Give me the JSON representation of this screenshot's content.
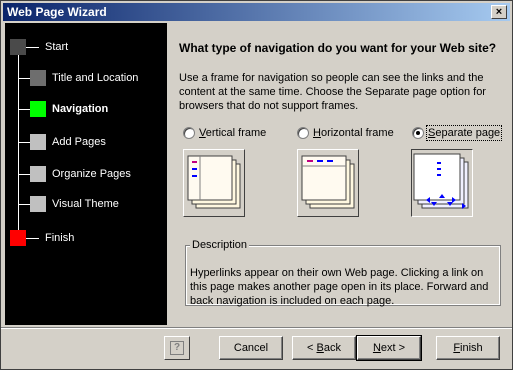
{
  "window": {
    "title": "Web Page Wizard",
    "close_label": "×"
  },
  "steps": [
    {
      "label": "Start",
      "state": "boundary",
      "color": "#4a4a4a"
    },
    {
      "label": "Title and Location",
      "state": "done",
      "color": "#6e6e6e"
    },
    {
      "label": "Navigation",
      "state": "current",
      "color": "#00ff00"
    },
    {
      "label": "Add Pages",
      "state": "pending",
      "color": "#c0c0c0"
    },
    {
      "label": "Organize Pages",
      "state": "pending",
      "color": "#c0c0c0"
    },
    {
      "label": "Visual Theme",
      "state": "pending",
      "color": "#c0c0c0"
    },
    {
      "label": "Finish",
      "state": "boundary",
      "color": "#ff0000"
    }
  ],
  "content": {
    "heading": "What type of navigation do you want for your Web site?",
    "intro": "Use a frame for navigation so people can see the links and the content at the same time.  Choose the Separate page option for browsers that do not support frames.",
    "options": [
      {
        "accel": "V",
        "rest": "ertical frame",
        "selected": false,
        "icon": "vertical-frame-icon"
      },
      {
        "accel": "H",
        "rest": "orizontal frame",
        "selected": false,
        "icon": "horizontal-frame-icon"
      },
      {
        "accel": "S",
        "rest": "eparate page",
        "selected": true,
        "icon": "separate-page-icon"
      }
    ],
    "description_title": "Description",
    "description": "Hyperlinks appear on their own Web page.  Clicking a link on this page makes another page open in its place.  Forward and back navigation is included on each page."
  },
  "buttons": {
    "help_glyph": "?",
    "cancel": "Cancel",
    "back_prefix": "< ",
    "back_accel": "B",
    "back_rest": "ack",
    "next_accel": "N",
    "next_rest": "ext >",
    "finish_accel": "F",
    "finish_rest": "inish"
  },
  "colors": {
    "titlebar_start": "#0a246a",
    "titlebar_end": "#a6caf0",
    "link_blue": "#0000ff",
    "link_magenta": "#c00080"
  }
}
